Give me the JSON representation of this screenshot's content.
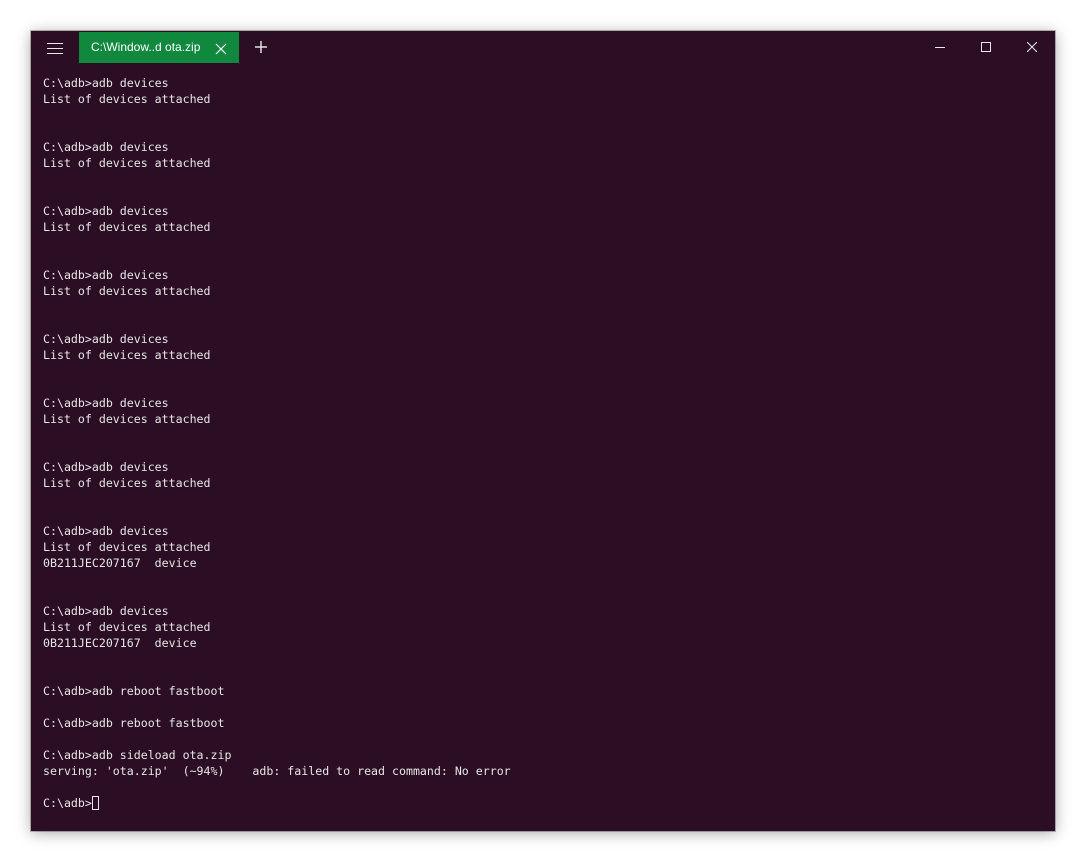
{
  "window": {
    "tab_title": "C:\\Window..d ota.zip",
    "icons": {
      "menu": "hamburger-menu-icon",
      "tab_close": "close-icon",
      "new_tab": "plus-icon",
      "minimize": "minimize-icon",
      "maximize": "maximize-icon",
      "close": "close-icon"
    }
  },
  "colors": {
    "terminal_background": "#2c0e24",
    "tab_background": "#10893e",
    "terminal_text": "#e6e6e6"
  },
  "terminal": {
    "lines": [
      "C:\\adb>adb devices",
      "List of devices attached",
      "",
      "",
      "C:\\adb>adb devices",
      "List of devices attached",
      "",
      "",
      "C:\\adb>adb devices",
      "List of devices attached",
      "",
      "",
      "C:\\adb>adb devices",
      "List of devices attached",
      "",
      "",
      "C:\\adb>adb devices",
      "List of devices attached",
      "",
      "",
      "C:\\adb>adb devices",
      "List of devices attached",
      "",
      "",
      "C:\\adb>adb devices",
      "List of devices attached",
      "",
      "",
      "C:\\adb>adb devices",
      "List of devices attached",
      "0B211JEC207167  device",
      "",
      "",
      "C:\\adb>adb devices",
      "List of devices attached",
      "0B211JEC207167  device",
      "",
      "",
      "C:\\adb>adb reboot fastboot",
      "",
      "C:\\adb>adb reboot fastboot",
      "",
      "C:\\adb>adb sideload ota.zip",
      "serving: 'ota.zip'  (~94%)    adb: failed to read command: No error",
      ""
    ],
    "prompt": "C:\\adb>"
  }
}
